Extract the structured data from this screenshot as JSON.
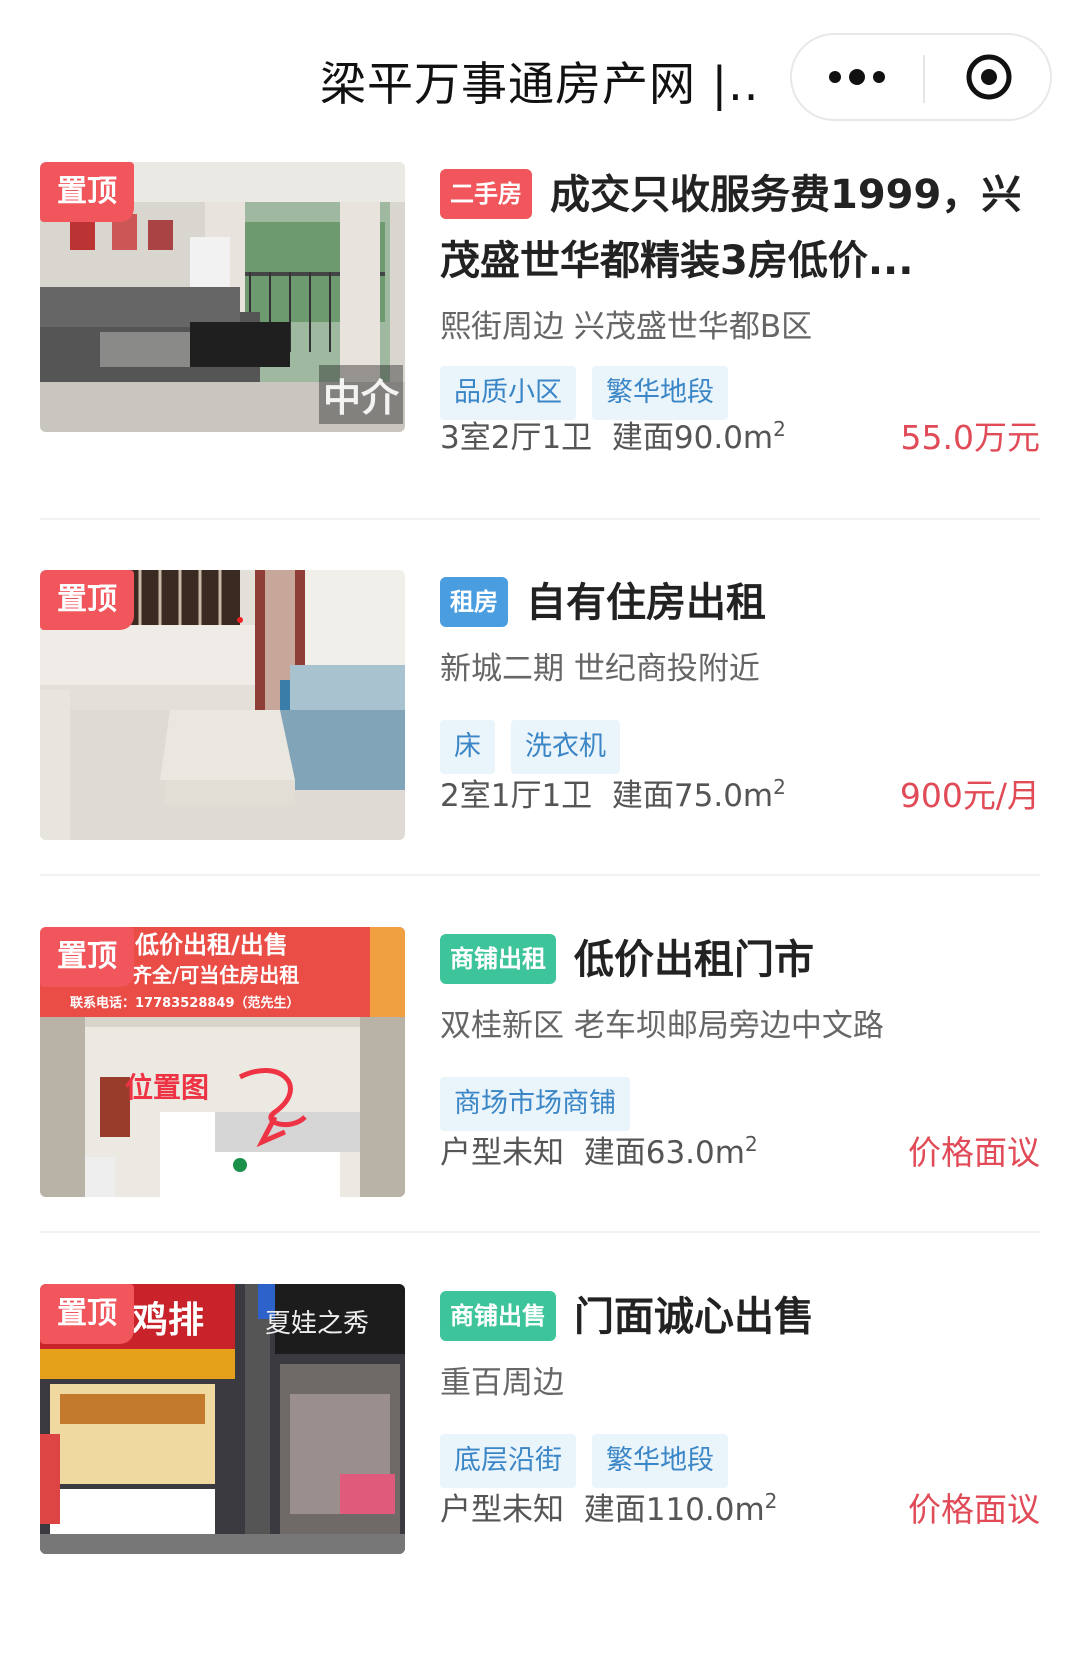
{
  "header": {
    "title": "梁平万事通房产网 |...",
    "more_icon": "more-dots-icon",
    "close_icon": "close-target-icon"
  },
  "colors": {
    "pin": "#f0565b",
    "price": "#e04b57",
    "tag_text": "#3b86c6",
    "tag_bg": "#eaf4fb",
    "type_secondhand": "#f0565b",
    "type_rent": "#4a9ee0",
    "type_shop": "#3ec49a"
  },
  "listings": [
    {
      "pin": "置顶",
      "watermark": "中介",
      "type": "二手房",
      "title": "成交只收服务费1999，兴茂盛世华都精装3房低价...",
      "address": "熙街周边 兴茂盛世华都B区",
      "tags": [
        "品质小区",
        "繁华地段"
      ],
      "layout": "3室2厅1卫",
      "area_prefix": "建面90.0m",
      "area_sup": "2",
      "price": "55.0万元"
    },
    {
      "pin": "置顶",
      "type": "租房",
      "title": "自有住房出租",
      "address": "新城二期 世纪商投附近",
      "tags": [
        "床",
        "洗衣机"
      ],
      "layout": "2室1厅1卫",
      "area_prefix": "建面75.0m",
      "area_sup": "2",
      "price": "900元/月"
    },
    {
      "pin": "置顶",
      "type": "商铺出租",
      "title": "低价出租门市",
      "address": "双桂新区 老车坝邮局旁边中文路",
      "tags": [
        "商场市场商铺"
      ],
      "layout": "户型未知",
      "area_prefix": "建面63.0m",
      "area_sup": "2",
      "price": "价格面议",
      "photo_text": {
        "banner": "低价出租/出售",
        "banner2": "齐全/可当住房出租",
        "phone": "联系电话：17783528849（范先生）",
        "map_label": "位置图"
      }
    },
    {
      "pin": "置顶",
      "type": "商铺出售",
      "title": "门面诚心出售",
      "address": "重百周边",
      "tags": [
        "底层沿街",
        "繁华地段"
      ],
      "layout": "户型未知",
      "area_prefix": "建面110.0m",
      "area_sup": "2",
      "price": "价格面议",
      "photo_text": {
        "sign_left": "鸡排",
        "sign_right": "夏娃之秀"
      }
    }
  ]
}
